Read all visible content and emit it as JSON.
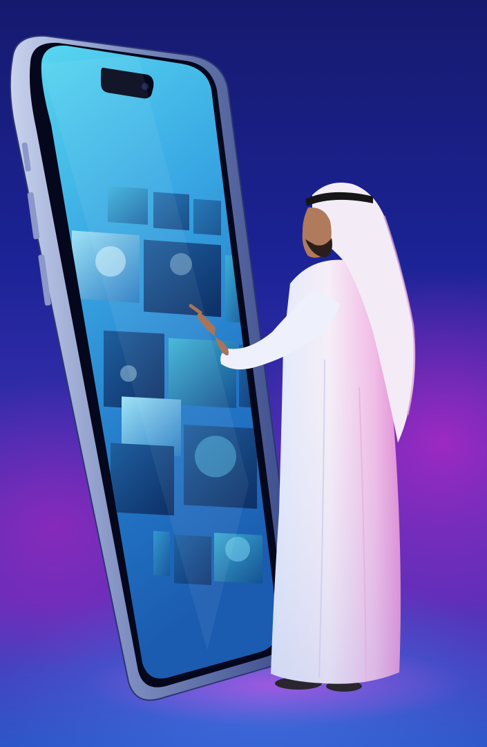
{
  "scene": {
    "description_label": "",
    "colors": {
      "background_top": "#161a6e",
      "background_mid": "#3a2fb0",
      "magenta_glow": "#be28c8",
      "phone_frame": "#9aa6c8",
      "screen_top": "#4fd2ee",
      "screen_bottom": "#1a64b8",
      "robe": "#f4eef6"
    },
    "icons": [
      "smartphone",
      "person-in-kandura",
      "media-thumbnail-grid"
    ]
  }
}
